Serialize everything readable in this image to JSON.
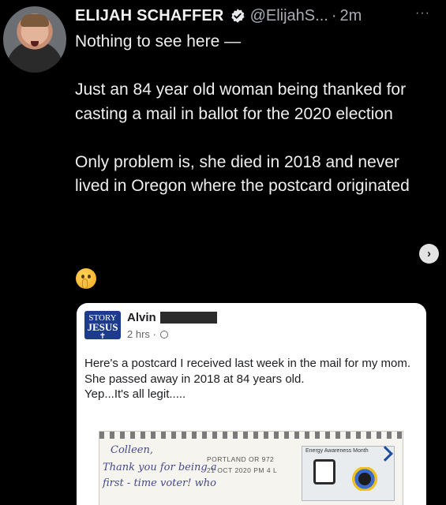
{
  "tweet": {
    "author_name": "ELIJAH SCHAFFER",
    "handle": "@ElijahS...",
    "separator": "·",
    "time": "2m",
    "more_label": "···",
    "paragraphs": [
      "Nothing to see here —",
      "Just an 84 year old woman being thanked for casting a mail in ballot for the 2020 election",
      "Only problem is, she died in 2018 and never lived in Oregon where the postcard originated"
    ],
    "emoji": "shushing-face",
    "next_button": "›"
  },
  "embedded_post": {
    "avatar_text": [
      "STORY",
      "JESUS"
    ],
    "author_first_name": "Alvin",
    "time": "2 hrs ·",
    "lines": [
      "Here's a postcard I received last week in the mail for my mom.",
      "She passed away in 2018 at 84 years old.",
      "Yep...It's all legit....."
    ],
    "postcard": {
      "handwriting": [
        "Colleen,",
        "Thank you for being a",
        "first - time voter! who"
      ],
      "postmark_line1": "PORTLAND OR  972",
      "postmark_line2": "21 OCT 2020  PM 4  L",
      "stamp_title": "Energy Awareness Month"
    }
  },
  "colors": {
    "background": "#000000",
    "text": "#efefef",
    "handle": "#a8adb2",
    "verified": "#e7e9ea",
    "card": "#ffffff"
  }
}
